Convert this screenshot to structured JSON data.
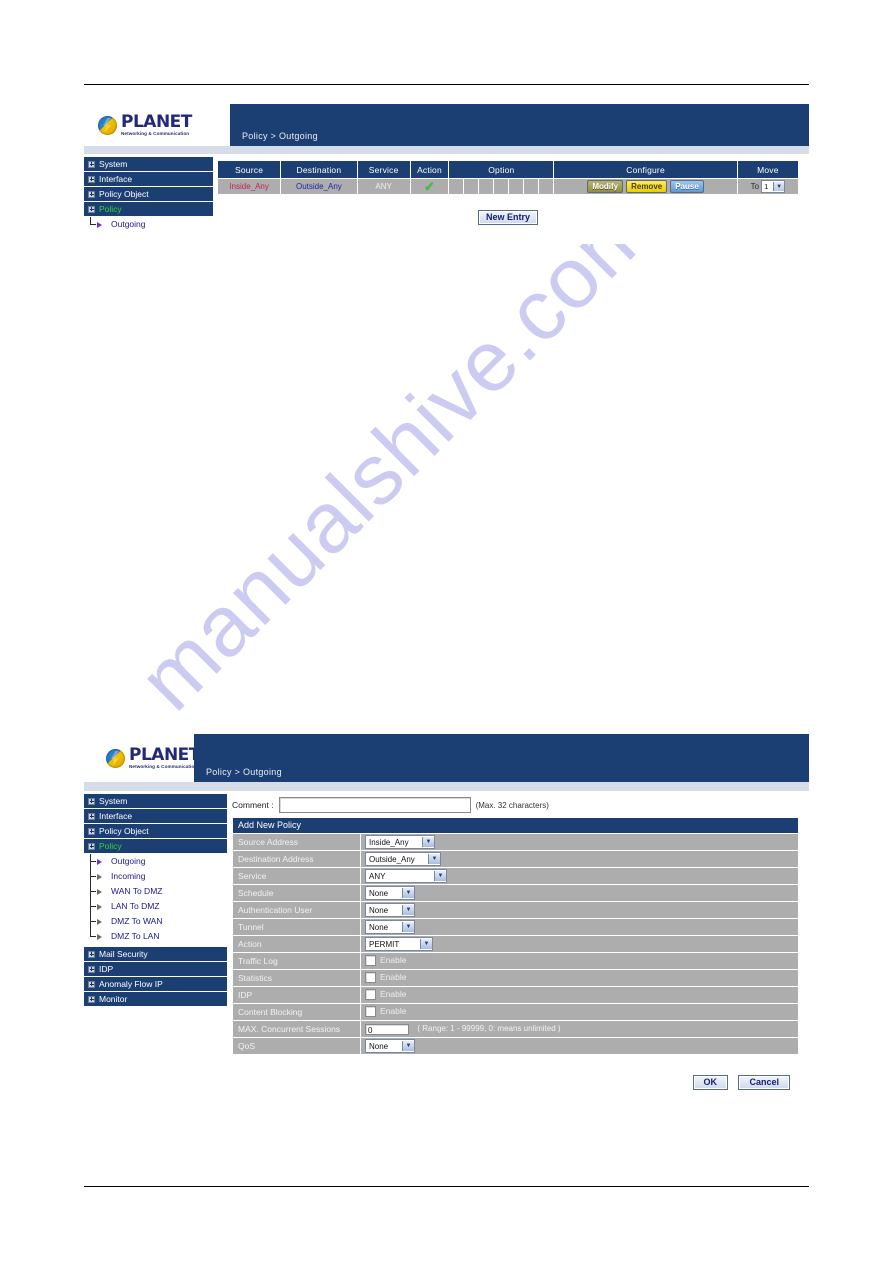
{
  "watermark": {
    "text": "manualshive.com"
  },
  "panel_top": {
    "logo": {
      "name": "PLANET",
      "tagline": "Networking & Communication"
    },
    "breadcrumb": "Policy > Outgoing",
    "sidebar": {
      "items": [
        {
          "label": "System",
          "active": false
        },
        {
          "label": "Interface",
          "active": false
        },
        {
          "label": "Policy Object",
          "active": false
        },
        {
          "label": "Policy",
          "active": true
        }
      ],
      "subitems": [
        {
          "label": "Outgoing",
          "active": true
        }
      ]
    },
    "table": {
      "headers": [
        "Source",
        "Destination",
        "Service",
        "Action",
        "Option",
        "Configure",
        "Move"
      ],
      "rows": [
        {
          "source": "Inside_Any",
          "destination": "Outside_Any",
          "service": "ANY",
          "action_icon": "check-icon",
          "option_cells": 7,
          "configure": [
            "Modify",
            "Remove",
            "Pause"
          ],
          "move_label": "To",
          "move_value": "1"
        }
      ]
    },
    "new_entry_label": "New Entry"
  },
  "panel_bottom": {
    "logo": {
      "name": "PLANET",
      "tagline": "Networking & Communication"
    },
    "breadcrumb": "Policy > Outgoing",
    "sidebar": {
      "items": [
        {
          "label": "System",
          "active": false
        },
        {
          "label": "Interface",
          "active": false
        },
        {
          "label": "Policy Object",
          "active": false
        },
        {
          "label": "Policy",
          "active": true
        }
      ],
      "subitems": [
        {
          "label": "Outgoing",
          "active": true
        },
        {
          "label": "Incoming",
          "active": false
        },
        {
          "label": "WAN To DMZ",
          "active": false
        },
        {
          "label": "LAN To DMZ",
          "active": false
        },
        {
          "label": "DMZ To WAN",
          "active": false
        },
        {
          "label": "DMZ To LAN",
          "active": false
        }
      ],
      "items_after": [
        {
          "label": "Mail Security",
          "active": false
        },
        {
          "label": "IDP",
          "active": false
        },
        {
          "label": "Anomaly Flow IP",
          "active": false
        },
        {
          "label": "Monitor",
          "active": false
        }
      ]
    },
    "form": {
      "comment_label": "Comment :",
      "comment_value": "",
      "comment_placeholder": "",
      "comment_hint": "(Max. 32 characters)",
      "section_title": "Add New Policy",
      "rows": {
        "source_address": {
          "label": "Source Address",
          "value": "Inside_Any"
        },
        "destination_address": {
          "label": "Destination Address",
          "value": "Outside_Any"
        },
        "service": {
          "label": "Service",
          "value": "ANY"
        },
        "schedule": {
          "label": "Schedule",
          "value": "None"
        },
        "authentication_user": {
          "label": "Authentication User",
          "value": "None"
        },
        "tunnel": {
          "label": "Tunnel",
          "value": "None"
        },
        "action": {
          "label": "Action",
          "value": "PERMIT"
        },
        "traffic_log": {
          "label": "Traffic Log",
          "checkbox_label": "Enable"
        },
        "statistics": {
          "label": "Statistics",
          "checkbox_label": "Enable"
        },
        "idp": {
          "label": "IDP",
          "checkbox_label": "Enable"
        },
        "content_blocking": {
          "label": "Content Blocking",
          "checkbox_label": "Enable"
        },
        "max_concurrent_sessions": {
          "label": "MAX. Concurrent Sessions",
          "value": "0",
          "hint": "( Range: 1 - 99999, 0: means unlimited )"
        },
        "qos": {
          "label": "QoS",
          "value": "None"
        }
      },
      "ok_label": "OK",
      "cancel_label": "Cancel"
    }
  }
}
